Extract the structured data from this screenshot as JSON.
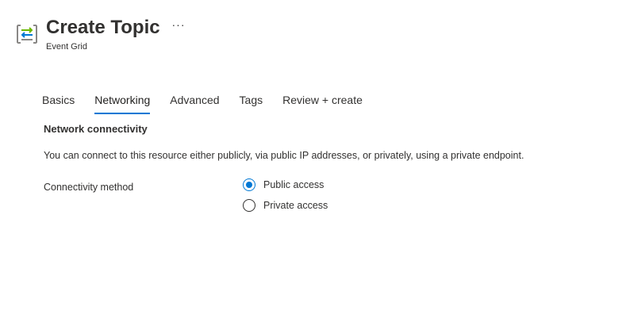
{
  "header": {
    "title": "Create Topic",
    "subtitle": "Event Grid",
    "more_label": "···",
    "icon": "event-grid-topic-icon"
  },
  "tabs": [
    {
      "label": "Basics",
      "active": false
    },
    {
      "label": "Networking",
      "active": true
    },
    {
      "label": "Advanced",
      "active": false
    },
    {
      "label": "Tags",
      "active": false
    },
    {
      "label": "Review + create",
      "active": false
    }
  ],
  "networking": {
    "heading": "Network connectivity",
    "description": "You can connect to this resource either publicly, via public IP addresses, or privately, using a private endpoint.",
    "connectivity_label": "Connectivity method",
    "options": [
      {
        "label": "Public access",
        "selected": true
      },
      {
        "label": "Private access",
        "selected": false
      }
    ]
  },
  "colors": {
    "accent": "#0078d4",
    "text": "#323130",
    "icon_green": "#6bb700",
    "icon_blue": "#0078d4",
    "icon_gray": "#8a8886"
  }
}
